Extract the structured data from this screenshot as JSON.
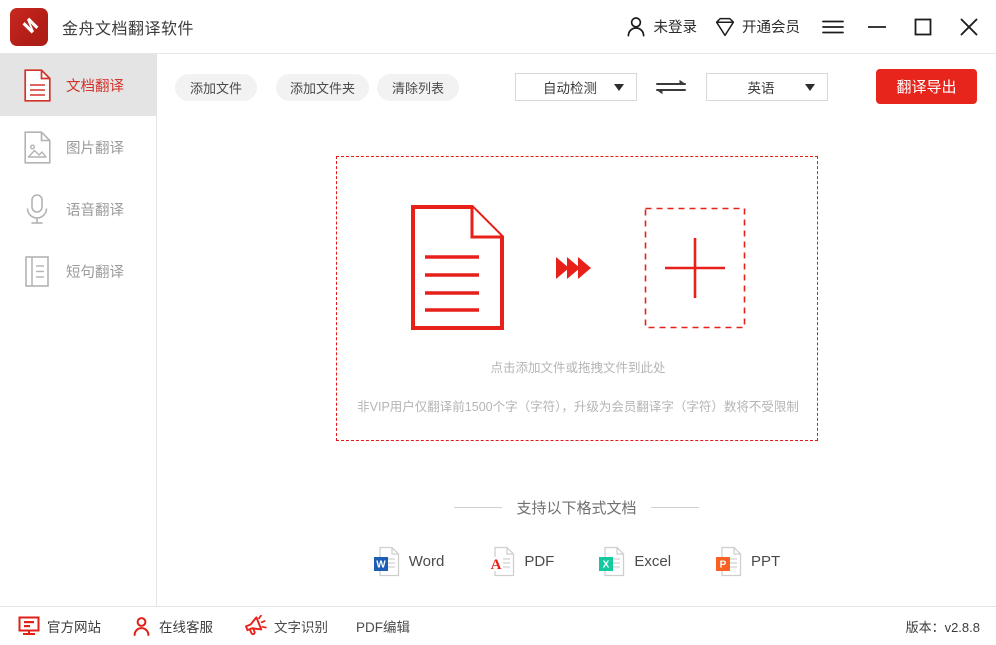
{
  "window": {
    "app_title": "金舟文档翻译软件",
    "logo_icon": "jinzhou-logo-icon",
    "account": {
      "icon": "person-icon",
      "label": "未登录"
    },
    "vip": {
      "icon": "diamond-icon",
      "label": "开通会员"
    },
    "controls": {
      "menu": "hamburger-icon",
      "minimize": "minimize-icon",
      "maximize": "maximize-icon",
      "close": "close-icon"
    }
  },
  "sidebar": {
    "items": [
      {
        "label": "文档翻译",
        "icon": "document-icon",
        "active": true
      },
      {
        "label": "图片翻译",
        "icon": "image-icon",
        "active": false
      },
      {
        "label": "语音翻译",
        "icon": "microphone-icon",
        "active": false
      },
      {
        "label": "短句翻译",
        "icon": "phrase-icon",
        "active": false
      }
    ]
  },
  "toolbar": {
    "add_file": "添加文件",
    "add_folder": "添加文件夹",
    "clear_list": "清除列表",
    "source_language": "自动检测",
    "target_language": "英语",
    "swap_icon": "swap-arrows-icon",
    "translate_export": "翻译导出"
  },
  "dropzone": {
    "doc_icon": "file-document-icon",
    "arrow_icon": "double-chevron-right-icon",
    "plus_icon": "plus-icon",
    "hint_main": "点击添加文件或拖拽文件到此处",
    "hint_sub": "非VIP用户仅翻译前1500个字（字符），升级为会员翻译字（字符）数将不受限制"
  },
  "formats": {
    "heading": "支持以下格式文档",
    "items": [
      {
        "label": "Word",
        "icon": "word-file-icon",
        "badge": "W",
        "color": "#1b5eb4"
      },
      {
        "label": "PDF",
        "icon": "pdf-file-icon",
        "badge": "A",
        "color": "#e8201a"
      },
      {
        "label": "Excel",
        "icon": "excel-file-icon",
        "badge": "X",
        "color": "#14c9a0"
      },
      {
        "label": "PPT",
        "icon": "ppt-file-icon",
        "badge": "P",
        "color": "#fa6021"
      }
    ]
  },
  "statusbar": {
    "website": {
      "label": "官方网站",
      "icon": "monitor-icon"
    },
    "service": {
      "label": "在线客服",
      "icon": "headset-person-icon"
    },
    "ocr": {
      "label": "文字识别",
      "icon": "megaphone-icon"
    },
    "pdf_edit": {
      "label": "PDF编辑"
    },
    "version": "版本：v2.8.8"
  },
  "colors": {
    "brand_red": "#e8251c",
    "logo_red": "#bd241b",
    "active_sidebar_bg": "#e4e4e4",
    "muted_text": "#9b9b9b"
  }
}
